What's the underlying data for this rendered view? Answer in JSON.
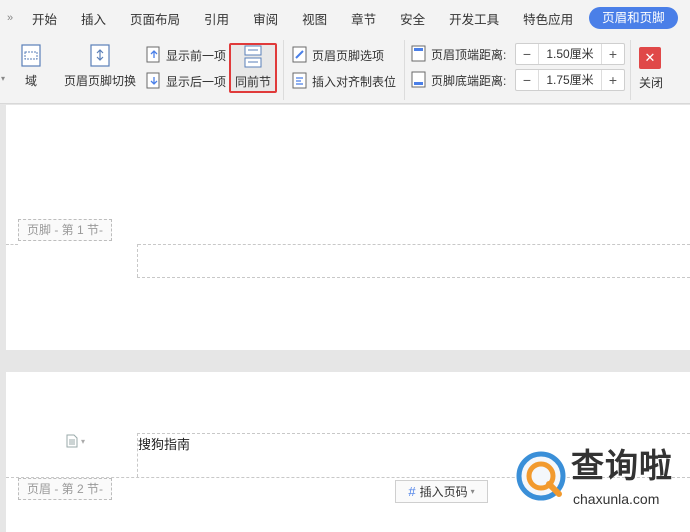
{
  "menu": {
    "overflow_icon": "double-chevron-right-icon",
    "items": [
      {
        "label": "开始"
      },
      {
        "label": "插入"
      },
      {
        "label": "页面布局"
      },
      {
        "label": "引用"
      },
      {
        "label": "审阅"
      },
      {
        "label": "视图"
      },
      {
        "label": "章节"
      },
      {
        "label": "安全"
      },
      {
        "label": "开发工具"
      },
      {
        "label": "特色应用"
      }
    ],
    "active_tab": "页眉和页脚"
  },
  "ribbon": {
    "field_label": "域",
    "switch_label": "页眉页脚切换",
    "show_prev_label": "显示前一项",
    "show_next_label": "显示后一项",
    "same_as_prev_label": "同前节",
    "hf_options_label": "页眉页脚选项",
    "insert_align_tab_label": "插入对齐制表位",
    "header_top_label": "页眉顶端距离:",
    "header_top_value": "1.50厘米",
    "footer_bottom_label": "页脚底端距离:",
    "footer_bottom_value": "1.75厘米",
    "close_label": "关闭",
    "highlight_color": "#e03a3a",
    "accent_color": "#4a7fe8"
  },
  "document": {
    "footer1_tag": "页脚 - 第 1 节-",
    "header2_tag": "页眉 - 第 2 节-",
    "footer_text": "搜狗指南",
    "insert_page_number_label": "插入页码"
  },
  "watermark": {
    "brand": "查询啦",
    "url": "chaxunla.com"
  }
}
